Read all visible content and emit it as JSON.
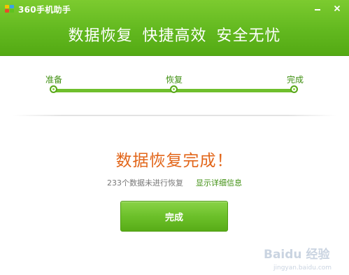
{
  "window": {
    "app_title": "360手机助手"
  },
  "header": {
    "slogan": "数据恢复 快捷高效 安全无忧"
  },
  "progress": {
    "steps": [
      {
        "label": "准备"
      },
      {
        "label": "恢复"
      },
      {
        "label": "完成"
      }
    ]
  },
  "result": {
    "title": "数据恢复完成！",
    "unrestored_text": "233个数据未进行恢复",
    "details_link": "显示详细信息",
    "finish_button": "完成"
  },
  "watermark": {
    "brand": "Baidu 经验",
    "url": "jingyan.baidu.com"
  },
  "colors": {
    "header_green": "#62b81f",
    "accent_green": "#3f8f10",
    "title_orange": "#e2661a"
  }
}
